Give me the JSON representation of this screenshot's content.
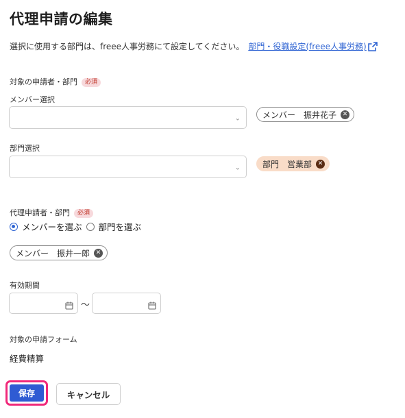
{
  "page": {
    "title": "代理申請の編集",
    "description": "選択に使用する部門は、freee人事労務にて設定してください。",
    "settings_link": "部門・役職設定(freee人事労務)"
  },
  "target_section": {
    "label": "対象の申請者・部門",
    "required_badge": "必須",
    "member_field_label": "メンバー選択",
    "member_select_value": "",
    "member_chip": "メンバー　振井花子",
    "dept_field_label": "部門選択",
    "dept_select_value": "",
    "dept_chip": "部門　営業部"
  },
  "proxy_section": {
    "label": "代理申請者・部門",
    "required_badge": "必須",
    "radio_member": "メンバーを選ぶ",
    "radio_dept": "部門を選ぶ",
    "selected_radio": "member",
    "member_chip": "メンバー　振井一郎"
  },
  "period": {
    "label": "有効期間",
    "start_value": "",
    "end_value": "",
    "separator": "〜"
  },
  "form": {
    "label": "対象の申請フォーム",
    "value": "経費精算"
  },
  "actions": {
    "save": "保存",
    "cancel": "キャンセル"
  },
  "colors": {
    "accent": "#2f5bd3",
    "highlight_border": "#f0287a",
    "dept_chip_bg": "#f9dcc8",
    "required_bg": "#f7d9dc"
  }
}
